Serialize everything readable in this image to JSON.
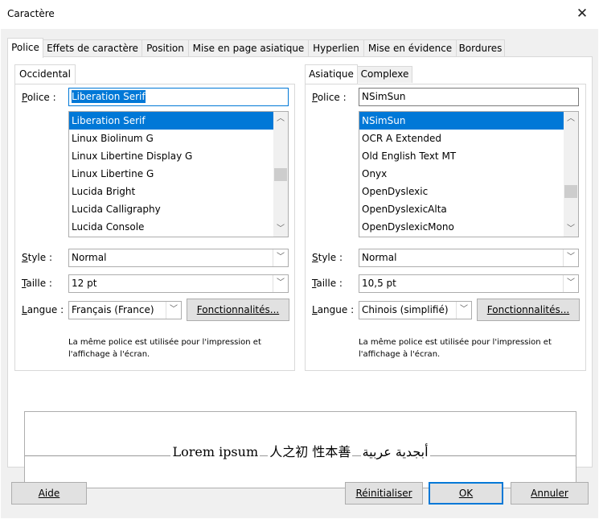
{
  "window": {
    "title": "Caractère"
  },
  "tabs": [
    "Police",
    "Effets de caractère",
    "Position",
    "Mise en page asiatique",
    "Hyperlien",
    "Mise en évidence",
    "Bordures"
  ],
  "western": {
    "group_tab": "Occidental",
    "font_label": "Police :",
    "font_value": "Liberation Serif",
    "font_list": [
      "Liberation Serif",
      "Linux Biolinum G",
      "Linux Libertine Display G",
      "Linux Libertine G",
      "Lucida Bright",
      "Lucida Calligraphy",
      "Lucida Console"
    ],
    "style_label": "Style :",
    "style_value": "Normal",
    "size_label": "Taille :",
    "size_value": "12 pt",
    "lang_label": "Langue :",
    "lang_value": "Français (France)",
    "features_button": "Fonctionnalités...",
    "note": "La même police est utilisée pour l'impression et l'affichage à l'écran."
  },
  "asian": {
    "group_tabs": [
      "Asiatique",
      "Complexe"
    ],
    "font_label": "Police :",
    "font_value": "NSimSun",
    "font_list": [
      "NSimSun",
      "OCR A Extended",
      "Old English Text MT",
      "Onyx",
      "OpenDyslexic",
      "OpenDyslexicAlta",
      "OpenDyslexicMono"
    ],
    "style_label": "Style :",
    "style_value": "Normal",
    "size_label": "Taille :",
    "size_value": "10,5 pt",
    "lang_label": "Langue :",
    "lang_value": "Chinois (simplifié)",
    "features_button": "Fonctionnalités...",
    "note": "La même police est utilisée pour l'impression et l'affichage à l'écran."
  },
  "preview": {
    "latin": "Lorem ipsum",
    "cjk": "人之初 性本善",
    "arabic": "أبجدية عربية"
  },
  "buttons": {
    "help": "Aide",
    "reset": "Réinitialiser",
    "ok": "OK",
    "cancel": "Annuler"
  },
  "icons": {
    "close": "close-icon",
    "scroll_up": "chevron-up-icon",
    "scroll_down": "chevron-down-icon",
    "dropdown": "chevron-down-icon"
  },
  "colors": {
    "accent": "#0078d7",
    "dialog_bg": "#f0f0f0"
  }
}
